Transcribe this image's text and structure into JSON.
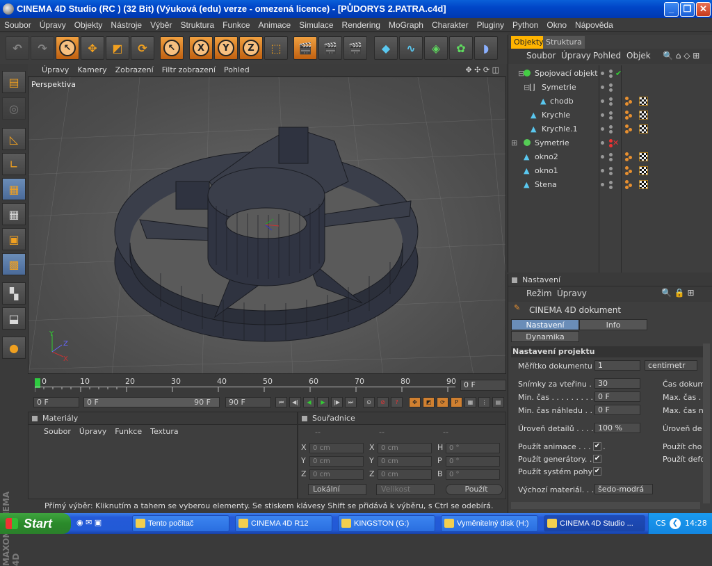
{
  "window": {
    "title": "CINEMA 4D Studio (RC ) (32 Bit) (Výuková (edu) verze - omezená licence) - [PŮDORYS 2.PATRA.c4d]"
  },
  "menu": [
    "Soubor",
    "Úpravy",
    "Objekty",
    "Nástroje",
    "Výběr",
    "Struktura",
    "Funkce",
    "Animace",
    "Simulace",
    "Rendering",
    "MoGraph",
    "Charakter",
    "Pluginy",
    "Python",
    "Okno",
    "Nápověda"
  ],
  "viewport": {
    "menu": [
      "Úpravy",
      "Kamery",
      "Zobrazení",
      "Filtr zobrazení",
      "Pohled"
    ],
    "label": "Perspektiva"
  },
  "timeline": {
    "ticks": [
      "0",
      "10",
      "20",
      "30",
      "40",
      "50",
      "60",
      "70",
      "80",
      "90"
    ],
    "frame": "0 F",
    "start": "0 F",
    "range_start": "0 F",
    "range_end": "90 F",
    "end": "90 F"
  },
  "materials": {
    "title": "Materiály",
    "menu": [
      "Soubor",
      "Úpravy",
      "Funkce",
      "Textura"
    ]
  },
  "coords": {
    "title": "Souřadnice",
    "headers": [
      "--",
      "--",
      "--"
    ],
    "rows": [
      {
        "a": "X",
        "av": "0 cm",
        "b": "X",
        "bv": "0 cm",
        "c": "H",
        "cv": "0 °"
      },
      {
        "a": "Y",
        "av": "0 cm",
        "b": "Y",
        "bv": "0 cm",
        "c": "P",
        "cv": "0 °"
      },
      {
        "a": "Z",
        "av": "0 cm",
        "b": "Z",
        "bv": "0 cm",
        "c": "B",
        "cv": "0 °"
      }
    ],
    "mode": "Lokální",
    "size": "Velikost",
    "apply": "Použít"
  },
  "status": "Přímý výběr: Kliknutím a tahem se vyberou elementy. Se stiskem klávesy Shift se přidává k výběru, s Ctrl se odebírá.",
  "objects": {
    "tabs": [
      "Objekty",
      "Struktura"
    ],
    "menu": [
      "Soubor",
      "Úpravy",
      "Pohled",
      "Objek"
    ],
    "items": [
      {
        "name": "Spojovací objekt"
      },
      {
        "name": "Symetrie"
      },
      {
        "name": "chodb"
      },
      {
        "name": "Krychle"
      },
      {
        "name": "Krychle.1"
      },
      {
        "name": "Symetrie"
      },
      {
        "name": "okno2"
      },
      {
        "name": "okno1"
      },
      {
        "name": "Stena"
      }
    ]
  },
  "attributes": {
    "title": "Nastavení",
    "menu": [
      "Režim",
      "Úpravy"
    ],
    "doc": "CINEMA 4D dokument",
    "tabs": [
      "Nastavení projektu",
      "Info",
      "Dynamika"
    ],
    "section": "Nastavení projektu",
    "scale_label": "Měřítko dokumentu",
    "scale_value": "1",
    "scale_unit": "centimetr",
    "fps_label": "Snímky za vteřinu . . .",
    "fps_value": "30",
    "min_label": "Min. čas . . . . . . . . . . .",
    "min_value": "0 F",
    "minprev_label": "Min. čas náhledu . . .",
    "minprev_value": "0 F",
    "lod_label": "Úroveň detailů . . . . .",
    "lod_value": "100 %",
    "use_anim": "Použít animace . . . . . .",
    "use_gen": "Použít generátory. . . .",
    "use_motion": "Použít systém pohybu",
    "default_mat": "Výchozí materiál. . . . .",
    "default_mat_value": "šedo-modrá",
    "right_col": [
      "Čas dokum",
      "Max. čas .",
      "Max. čas n",
      "Úroveň de",
      "Použít cho",
      "Použít defo"
    ]
  },
  "taskbar": {
    "start": "Start",
    "tasks": [
      "Tento počítač",
      "CINEMA 4D R12",
      "KINGSTON (G:)",
      "Vyměnitelný disk (H:)",
      "CINEMA 4D Studio ..."
    ],
    "lang": "CS",
    "clock": "14:28"
  }
}
